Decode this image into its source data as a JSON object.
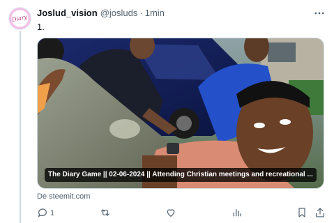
{
  "tweet": {
    "display_name": "Joslud_vision",
    "handle": "@josluds",
    "separator": "·",
    "time": "1min",
    "text": "1.",
    "avatar_text": "Diary"
  },
  "card": {
    "title": "The Diary Game || 02-06-2024 || Attending Christian meetings and recreational ...",
    "source": "De steemit.com"
  },
  "actions": {
    "reply_count": "1",
    "retweet_count": "",
    "like_count": "",
    "views_count": ""
  },
  "icons": [
    "more-icon",
    "reply-icon",
    "retweet-icon",
    "like-icon",
    "views-icon",
    "bookmark-icon",
    "share-icon"
  ],
  "colors": {
    "text_primary": "#0f1419",
    "text_secondary": "#536471",
    "border": "#cfd9de"
  }
}
